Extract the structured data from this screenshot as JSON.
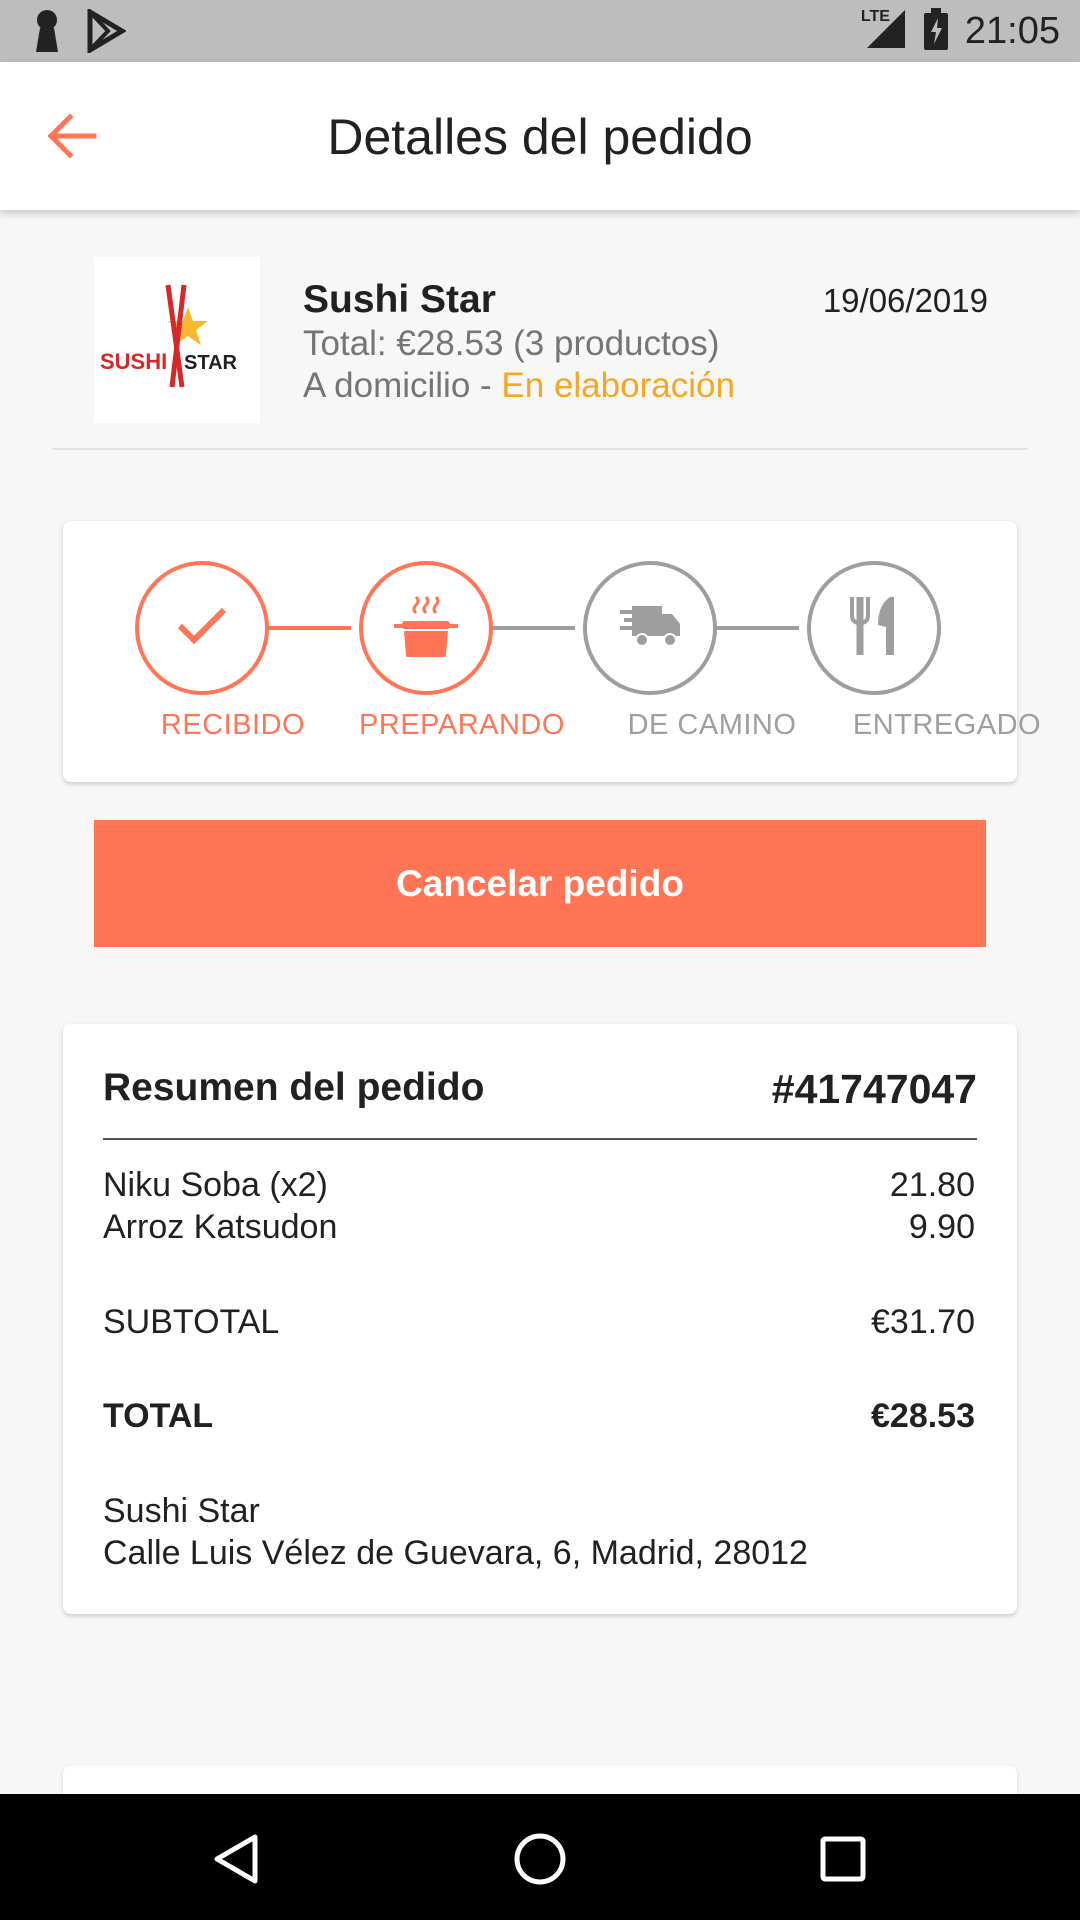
{
  "status_bar": {
    "time": "21:05",
    "network": "LTE",
    "icons": [
      "keyhole-icon",
      "play-store-icon",
      "signal-icon",
      "battery-icon"
    ]
  },
  "app_bar": {
    "title": "Detalles del pedido",
    "back_icon": "arrow-left-icon"
  },
  "restaurant": {
    "logo_text": "SUSHI STAR",
    "name": "Sushi Star",
    "date": "19/06/2019",
    "total_line": "Total: €28.53 (3 productos)",
    "delivery_type": "A domicilio - ",
    "status": "En elaboración"
  },
  "tracker": {
    "steps": [
      {
        "label": "RECIBIDO",
        "icon": "check-icon",
        "active": true
      },
      {
        "label": "PREPARANDO",
        "icon": "cooking-pot-icon",
        "active": true
      },
      {
        "label": "DE CAMINO",
        "icon": "delivery-truck-icon",
        "active": false
      },
      {
        "label": "ENTREGADO",
        "icon": "fork-knife-icon",
        "active": false
      }
    ]
  },
  "cancel_button": "Cancelar pedido",
  "summary": {
    "title": "Resumen del pedido",
    "order_number": "#41747047",
    "items": [
      {
        "name": "Niku Soba (x2)",
        "price": "21.80"
      },
      {
        "name": "Arroz Katsudon",
        "price": "9.90"
      }
    ],
    "subtotal_label": "SUBTOTAL",
    "subtotal_value": "€31.70",
    "total_label": "TOTAL",
    "total_value": "€28.53",
    "address_name": "Sushi Star",
    "address": "Calle Luis Vélez de Guevara, 6, Madrid, 28012"
  },
  "colors": {
    "accent": "#ff7555",
    "status_orange": "#f5a623",
    "inactive_gray": "#9e9e9e"
  },
  "nav_bar": {
    "icons": [
      "back-triangle-icon",
      "home-circle-icon",
      "recents-square-icon"
    ]
  }
}
